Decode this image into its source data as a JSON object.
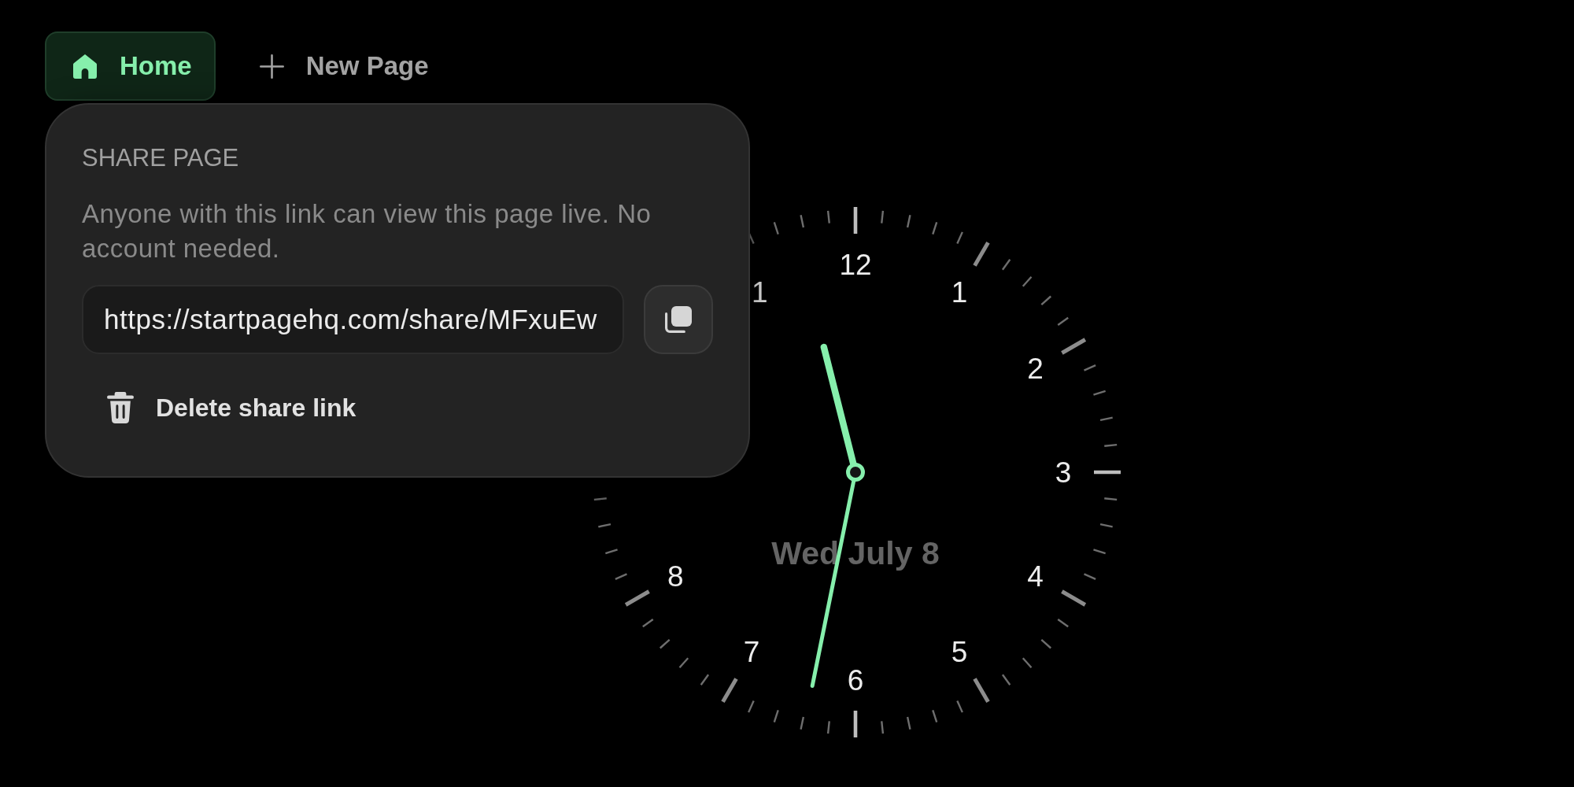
{
  "tabs": [
    {
      "label": "Home",
      "kind": "home",
      "selected": true
    }
  ],
  "new_page_button": {
    "label": "New Page"
  },
  "share_popover": {
    "title": "SHARE PAGE",
    "description": "Anyone with this link can view this page live. No account needed.",
    "link_field": {
      "value": "https://startpagehq.com/share/MFxuEw"
    },
    "delete_button": {
      "label": "Delete share link"
    }
  },
  "clock": {
    "numerals": [
      "12",
      "1",
      "2",
      "3",
      "4",
      "5",
      "6",
      "7",
      "8"
    ],
    "partly_covered_numeral": "1",
    "date": "Wed July 8"
  }
}
